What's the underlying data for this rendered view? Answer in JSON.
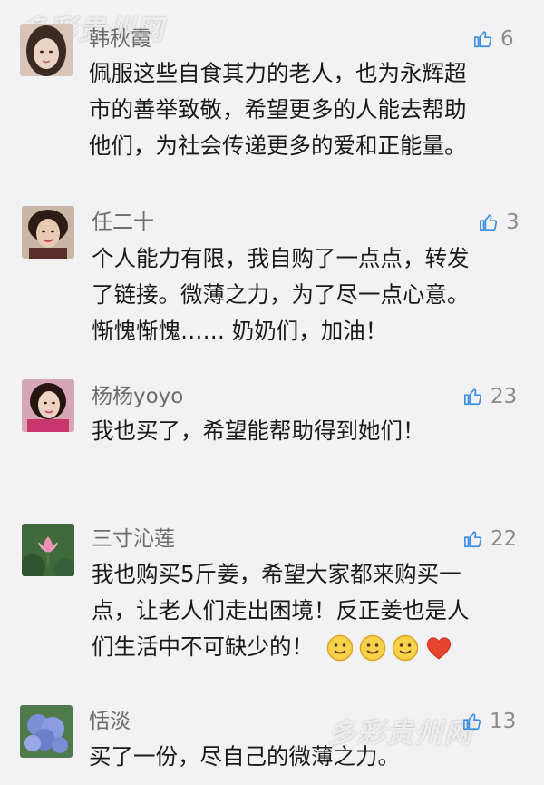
{
  "watermark": "多彩贵州网",
  "comments": [
    {
      "name": "韩秋霞",
      "likes": "6",
      "lines": [
        "佩服这些自食其力的老人，也为永辉超",
        "市的善举致敬，希望更多的人能去帮助",
        "他们，为社会传递更多的爱和正能量。"
      ]
    },
    {
      "name": "任二十",
      "likes": "3",
      "lines": [
        "个人能力有限，我自购了一点点，转发",
        "了链接。微薄之力，为了尽一点心意。",
        "惭愧惭愧…… 奶奶们，加油！"
      ]
    },
    {
      "name": "杨杨yoyo",
      "likes": "23",
      "lines": [
        "我也买了，希望能帮助得到她们！"
      ]
    },
    {
      "name": "三寸沁莲",
      "likes": "22",
      "lines": [
        "我也购买5斤姜，希望大家都来购买一",
        "点，让老人们走出困境！反正姜也是人",
        "们生活中不可缺少的！"
      ],
      "emojis": [
        "smile-emoji",
        "smile-emoji",
        "smile-emoji",
        "heart-emoji"
      ]
    },
    {
      "name": "恬淡",
      "likes": "13",
      "lines": [
        "买了一份，尽自己的微薄之力。"
      ]
    }
  ],
  "colors": {
    "background": "#f2f2f4",
    "name": "#6d6d6d",
    "text": "#1a1a1a",
    "like": "#8c8c8c"
  }
}
